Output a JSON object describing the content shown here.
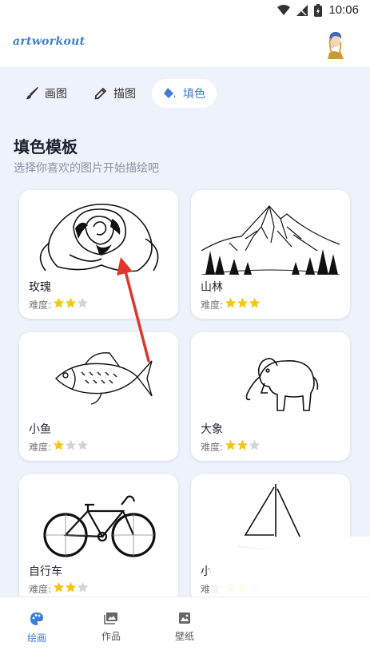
{
  "status": {
    "time": "10:06"
  },
  "app": {
    "brand": "artworkout"
  },
  "tabs": [
    {
      "label": "画图",
      "icon": "brush-icon"
    },
    {
      "label": "描图",
      "icon": "pencil-icon"
    },
    {
      "label": "填色",
      "icon": "paint-bucket-icon",
      "active": true
    }
  ],
  "section": {
    "title": "填色模板",
    "subtitle": "选择你喜欢的图片开始描绘吧"
  },
  "difficulty_label": "难度:",
  "templates": [
    {
      "name": "玫瑰",
      "difficulty": 2,
      "max": 3
    },
    {
      "name": "山林",
      "difficulty": 3,
      "max": 3
    },
    {
      "name": "小鱼",
      "difficulty": 1,
      "max": 3
    },
    {
      "name": "大象",
      "difficulty": 2,
      "max": 3
    },
    {
      "name": "自行车",
      "difficulty": 2,
      "max": 3
    },
    {
      "name": "小",
      "difficulty": 2,
      "max": 3
    }
  ],
  "bottom_nav": [
    {
      "label": "绘画",
      "icon": "palette-icon",
      "active": true
    },
    {
      "label": "作品",
      "icon": "gallery-icon"
    },
    {
      "label": "壁纸",
      "icon": "image-icon"
    }
  ],
  "colors": {
    "accent": "#3c7fd2",
    "star": "#f5c518",
    "star_empty": "#d0d3d9",
    "annotation_arrow": "#e0352b"
  }
}
